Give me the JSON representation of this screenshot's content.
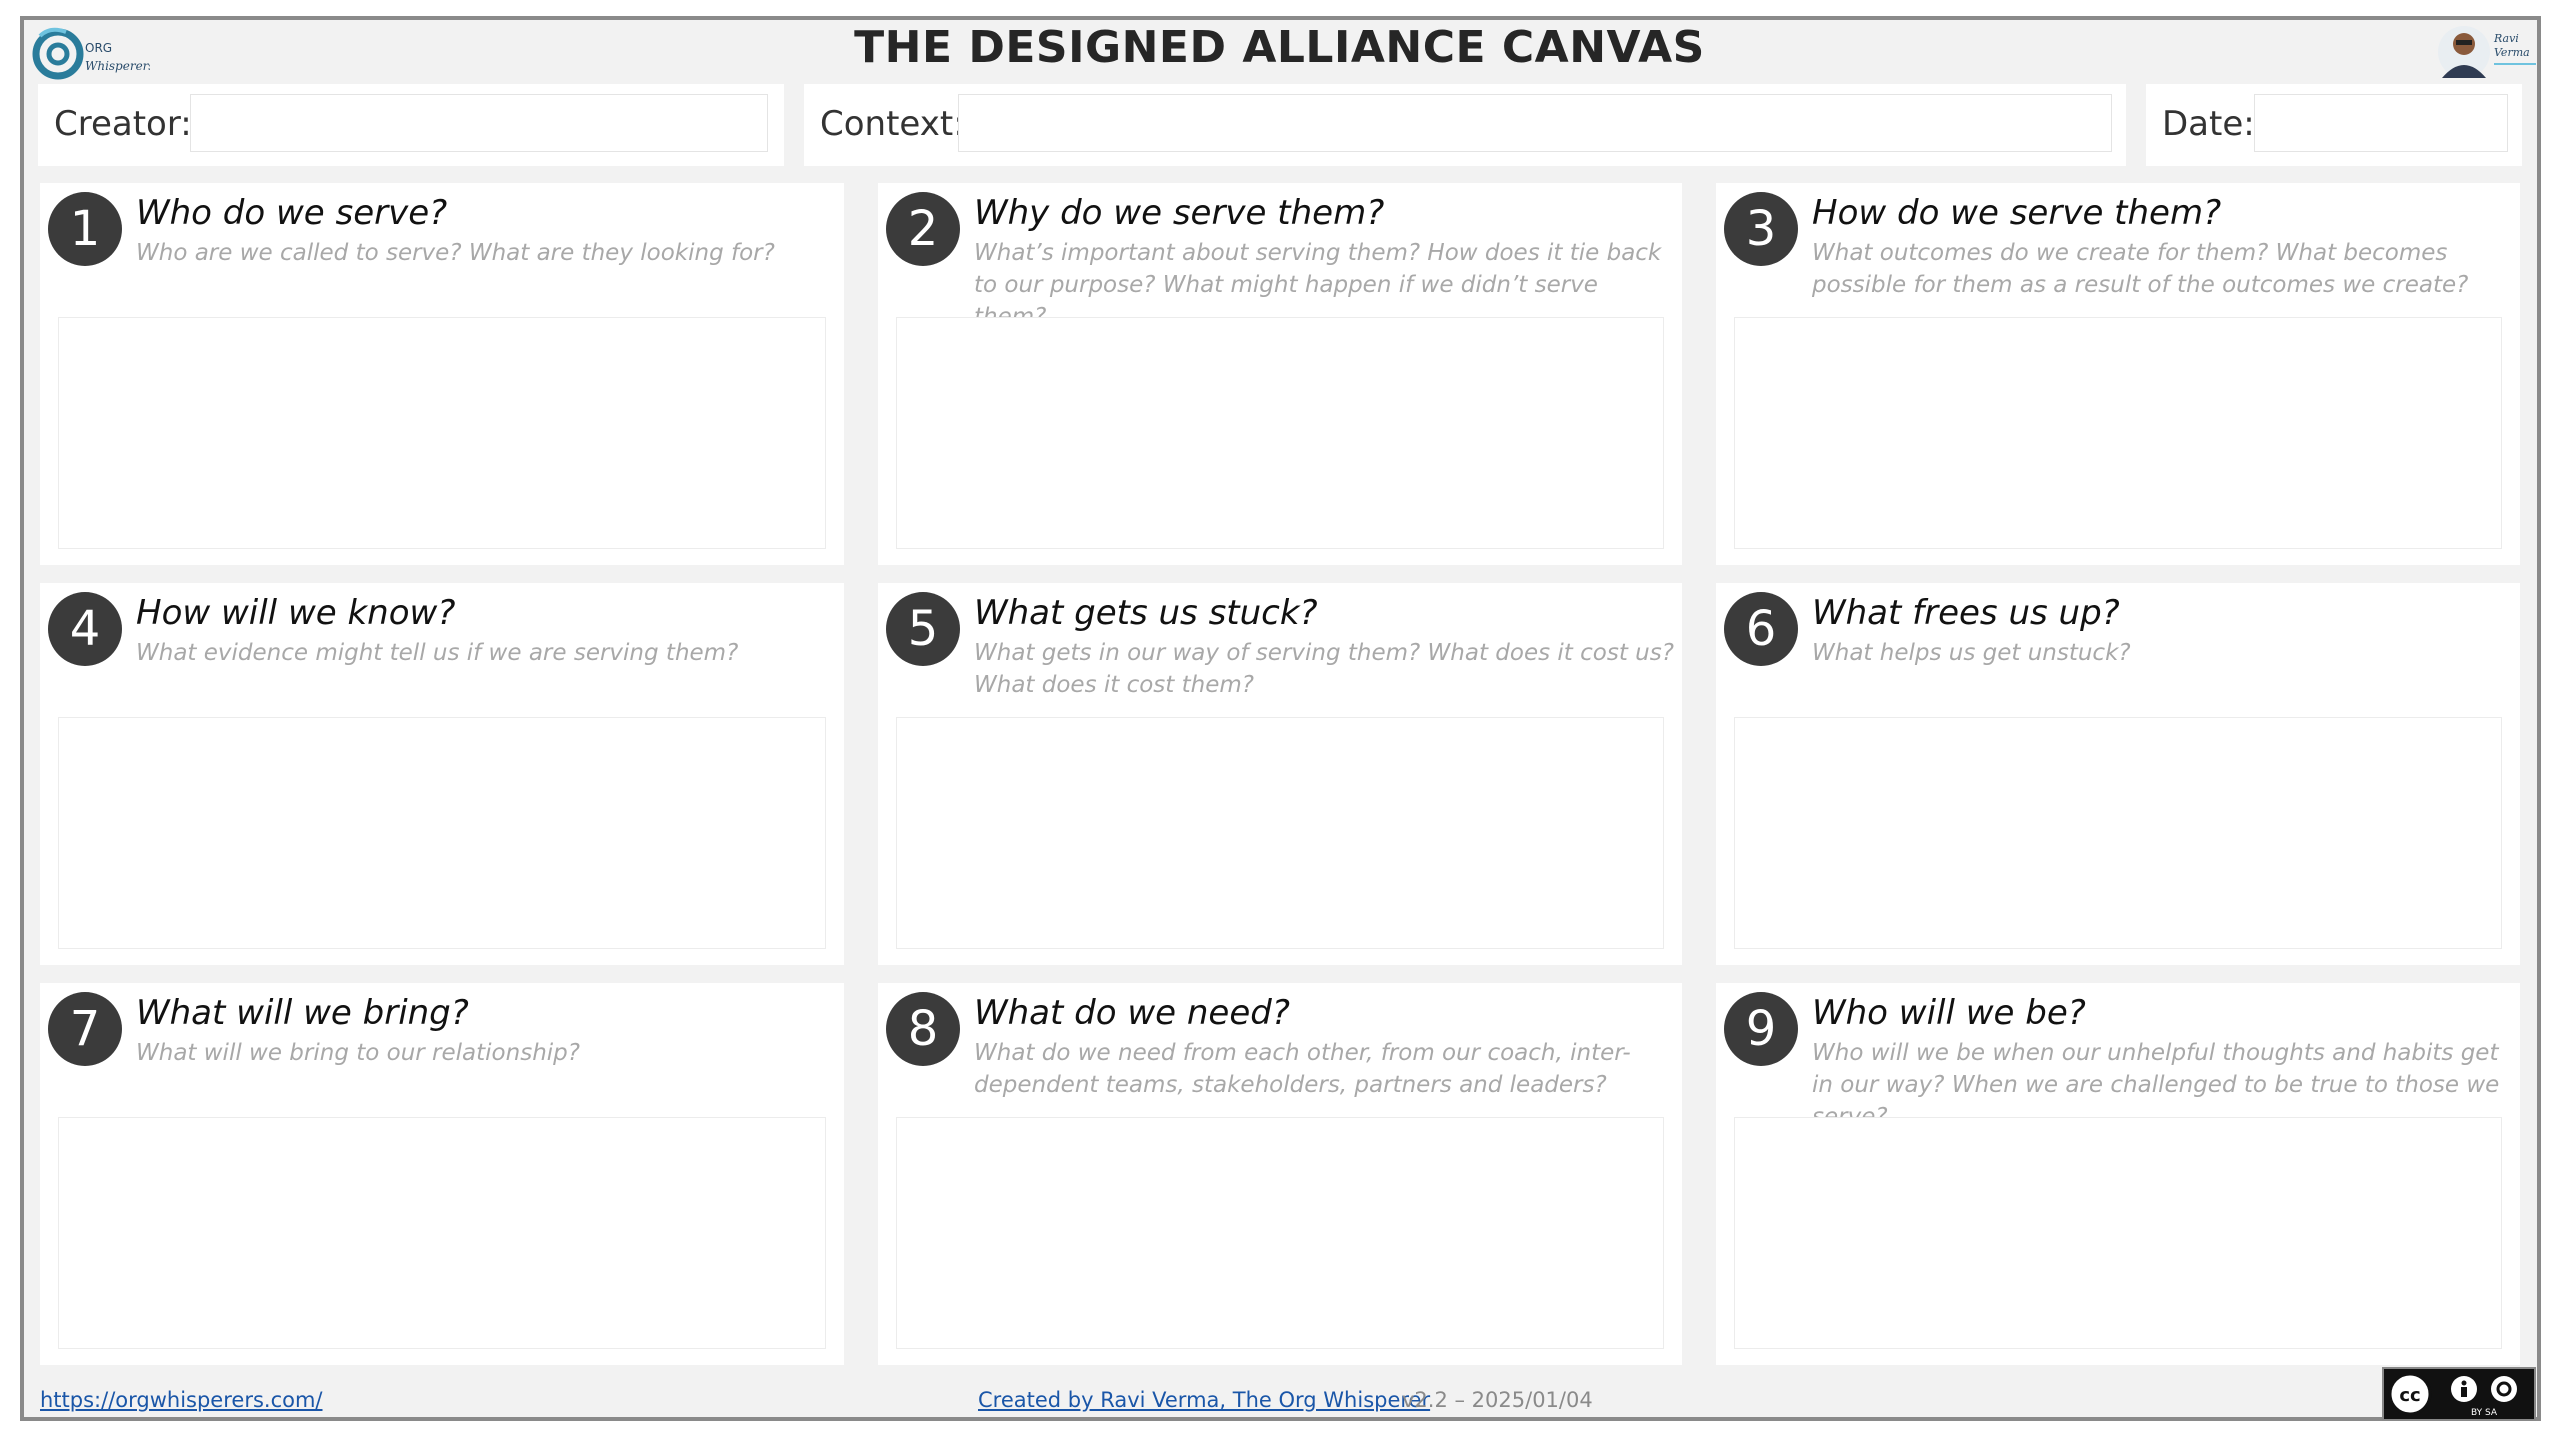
{
  "header": {
    "title": "THE DESIGNED ALLIANCE CANVAS",
    "logo_left_text": "ORG Whisperers",
    "logo_right_text": "Ravi Verma"
  },
  "meta": {
    "creator_label": "Creator:",
    "creator_value": "",
    "context_label": "Context:",
    "context_value": "",
    "date_label": "Date:",
    "date_value": ""
  },
  "cards": [
    {
      "number": "1",
      "question": "Who do we serve?",
      "prompt": "Who are we called to serve? What are they looking for?",
      "answer": ""
    },
    {
      "number": "2",
      "question": "Why do we serve them?",
      "prompt": "What’s important about serving them?  How does it tie back to our purpose? What might happen if we didn’t serve them?",
      "answer": ""
    },
    {
      "number": "3",
      "question": "How do we serve them?",
      "prompt": "What outcomes do we create for them? What becomes possible for them as a result of the outcomes we create?",
      "answer": ""
    },
    {
      "number": "4",
      "question": "How will we know?",
      "prompt": "What evidence might tell us if we are serving them?",
      "answer": ""
    },
    {
      "number": "5",
      "question": "What gets us stuck?",
      "prompt": "What gets in our way of serving them? What does it cost us? What does it cost them?",
      "answer": ""
    },
    {
      "number": "6",
      "question": "What frees us up?",
      "prompt": "What helps us get unstuck?",
      "answer": ""
    },
    {
      "number": "7",
      "question": "What will we bring?",
      "prompt": "What will we bring to our relationship?",
      "answer": ""
    },
    {
      "number": "8",
      "question": "What do we need?",
      "prompt": "What do we need from each other, from our coach, inter-dependent teams, stakeholders, partners and leaders?",
      "answer": ""
    },
    {
      "number": "9",
      "question": "Who will we be?",
      "prompt": "Who will we be when our unhelpful thoughts and habits get in our way? When we are challenged to be true to those we serve?",
      "answer": ""
    }
  ],
  "footer": {
    "website": "https://orgwhisperers.com/",
    "credit": "Created by Ravi Verma, The Org Whisperer",
    "version": "v2.2 – 2025/01/04",
    "license_text": "BY SA",
    "colors": {
      "link": "#1a56a8",
      "circle": "#3b3b3b",
      "prompt": "#a8a8a8"
    }
  }
}
